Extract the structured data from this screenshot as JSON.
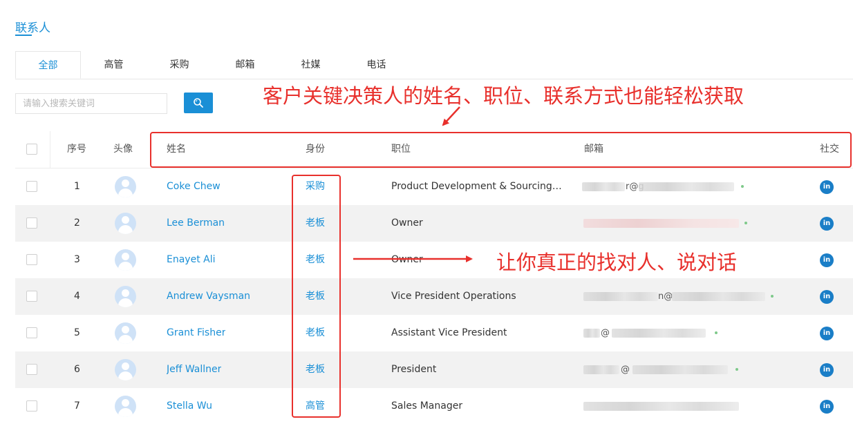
{
  "page_title": "联系人",
  "tabs": [
    {
      "label": "全部",
      "active": true
    },
    {
      "label": "高管",
      "active": false
    },
    {
      "label": "采购",
      "active": false
    },
    {
      "label": "邮箱",
      "active": false
    },
    {
      "label": "社媒",
      "active": false
    },
    {
      "label": "电话",
      "active": false
    }
  ],
  "search": {
    "placeholder": "请输入搜索关键词",
    "button_icon": "search-icon"
  },
  "annotations": {
    "top": "客户关键决策人的姓名、职位、联系方式也能轻松获取",
    "middle": "让你真正的找对人、说对话"
  },
  "table": {
    "headers": {
      "index": "序号",
      "avatar": "头像",
      "name": "姓名",
      "role": "身份",
      "position": "职位",
      "email": "邮箱",
      "social": "社交"
    },
    "rows": [
      {
        "index": "1",
        "name": "Coke Chew",
        "role": "采购",
        "position": "Product Development & Sourcing Dir...",
        "email_visible": "r@g",
        "social": "in"
      },
      {
        "index": "2",
        "name": "Lee Berman",
        "role": "老板",
        "position": "Owner",
        "email_visible": "",
        "social": "in"
      },
      {
        "index": "3",
        "name": "Enayet Ali",
        "role": "老板",
        "position": "Owner",
        "email_visible": "",
        "social": "in"
      },
      {
        "index": "4",
        "name": "Andrew Vaysman",
        "role": "老板",
        "position": "Vice President Operations",
        "email_visible": "n@",
        "social": "in"
      },
      {
        "index": "5",
        "name": "Grant Fisher",
        "role": "老板",
        "position": "Assistant Vice President",
        "email_visible": "@",
        "social": "in"
      },
      {
        "index": "6",
        "name": "Jeff Wallner",
        "role": "老板",
        "position": "President",
        "email_visible": "@",
        "social": "in"
      },
      {
        "index": "7",
        "name": "Stella Wu",
        "role": "高管",
        "position": "Sales Manager",
        "email_visible": "",
        "social": "in"
      }
    ]
  },
  "colors": {
    "accent": "#1a8fd6",
    "annotation": "#e8302c",
    "linkedin": "#1a7ec7"
  }
}
